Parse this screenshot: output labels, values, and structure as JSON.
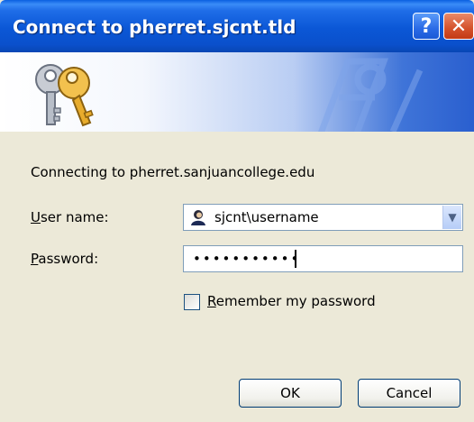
{
  "window": {
    "title": "Connect to pherret.sjcnt.tld",
    "help_label": "?",
    "close_label": "✕"
  },
  "dialog": {
    "connecting_text": "Connecting to pherret.sanjuancollege.edu",
    "username": {
      "label_first": "U",
      "label_rest": "ser name:",
      "value": "sjcnt\\username"
    },
    "password": {
      "label_first": "P",
      "label_rest": "assword:",
      "masked_value": "•••••••••••"
    },
    "remember": {
      "label_first": "R",
      "label_rest": "emember my password",
      "checked": false
    },
    "buttons": {
      "ok": "OK",
      "cancel": "Cancel"
    }
  }
}
